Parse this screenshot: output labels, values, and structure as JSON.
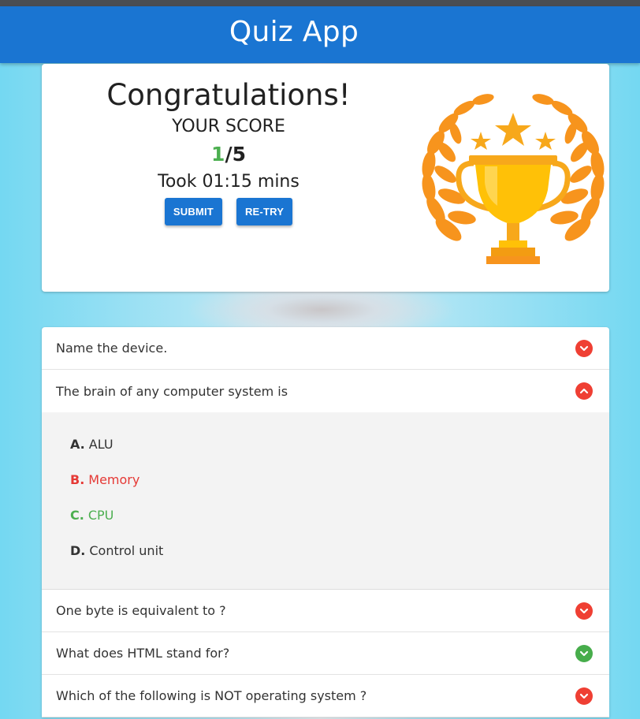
{
  "app": {
    "title": "Quiz App"
  },
  "result": {
    "heading": "Congratulations!",
    "score_label": "YOUR SCORE",
    "score_correct": "1",
    "score_total": "/5",
    "time_text": "Took 01:15 mins",
    "submit_label": "SUBMIT",
    "retry_label": "RE-TRY"
  },
  "questions": [
    {
      "text": "Name the device.",
      "status": "wrong",
      "expanded": false
    },
    {
      "text": "The brain of any computer system is",
      "status": "wrong",
      "expanded": true,
      "answers": [
        {
          "letter": "A.",
          "text": "ALU",
          "state": "neutral"
        },
        {
          "letter": "B.",
          "text": "Memory",
          "state": "selected-wrong"
        },
        {
          "letter": "C.",
          "text": "CPU",
          "state": "correct"
        },
        {
          "letter": "D.",
          "text": "Control unit",
          "state": "neutral"
        }
      ]
    },
    {
      "text": "One byte is equivalent to ?",
      "status": "wrong",
      "expanded": false
    },
    {
      "text": "What does HTML stand for?",
      "status": "correct",
      "expanded": false
    },
    {
      "text": "Which of the following is NOT operating system ?",
      "status": "wrong",
      "expanded": false
    }
  ],
  "colors": {
    "primary": "#1a75d2",
    "correct": "#4caf50",
    "wrong": "#ef3f33",
    "trophy_orange": "#f7941d",
    "trophy_gold": "#ffc107"
  },
  "icons": {
    "wrong_collapsed": "chevron-down-icon",
    "wrong_expanded": "chevron-up-icon",
    "correct": "check-icon",
    "trophy": "trophy-icon"
  }
}
